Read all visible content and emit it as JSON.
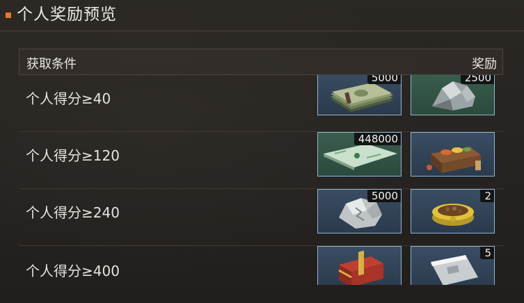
{
  "header": {
    "title": "个人奖励预览"
  },
  "table": {
    "col_condition": "获取条件",
    "col_reward": "奖励"
  },
  "rows": [
    {
      "condition": "个人得分≥40",
      "rewards": [
        {
          "icon": "cash-bundle-icon",
          "qty": "5000"
        },
        {
          "icon": "silver-ore-icon",
          "qty": "2500"
        }
      ]
    },
    {
      "condition": "个人得分≥120",
      "rewards": [
        {
          "icon": "voucher-icon",
          "qty": "448000"
        },
        {
          "icon": "food-crate-icon",
          "qty": ""
        }
      ]
    },
    {
      "condition": "个人得分≥240",
      "rewards": [
        {
          "icon": "crystal-stone-icon",
          "qty": "5000"
        },
        {
          "icon": "pet-food-bowl-icon",
          "qty": "2"
        }
      ]
    },
    {
      "condition": "个人得分≥400",
      "rewards": [
        {
          "icon": "red-treasure-chest-icon",
          "qty": ""
        },
        {
          "icon": "plastic-bag-icon",
          "qty": "5"
        }
      ]
    }
  ],
  "colors": {
    "accent": "#e07a2a",
    "item_border": "#8fb6d6",
    "item_blue": "#34475c",
    "item_green": "#345646"
  }
}
